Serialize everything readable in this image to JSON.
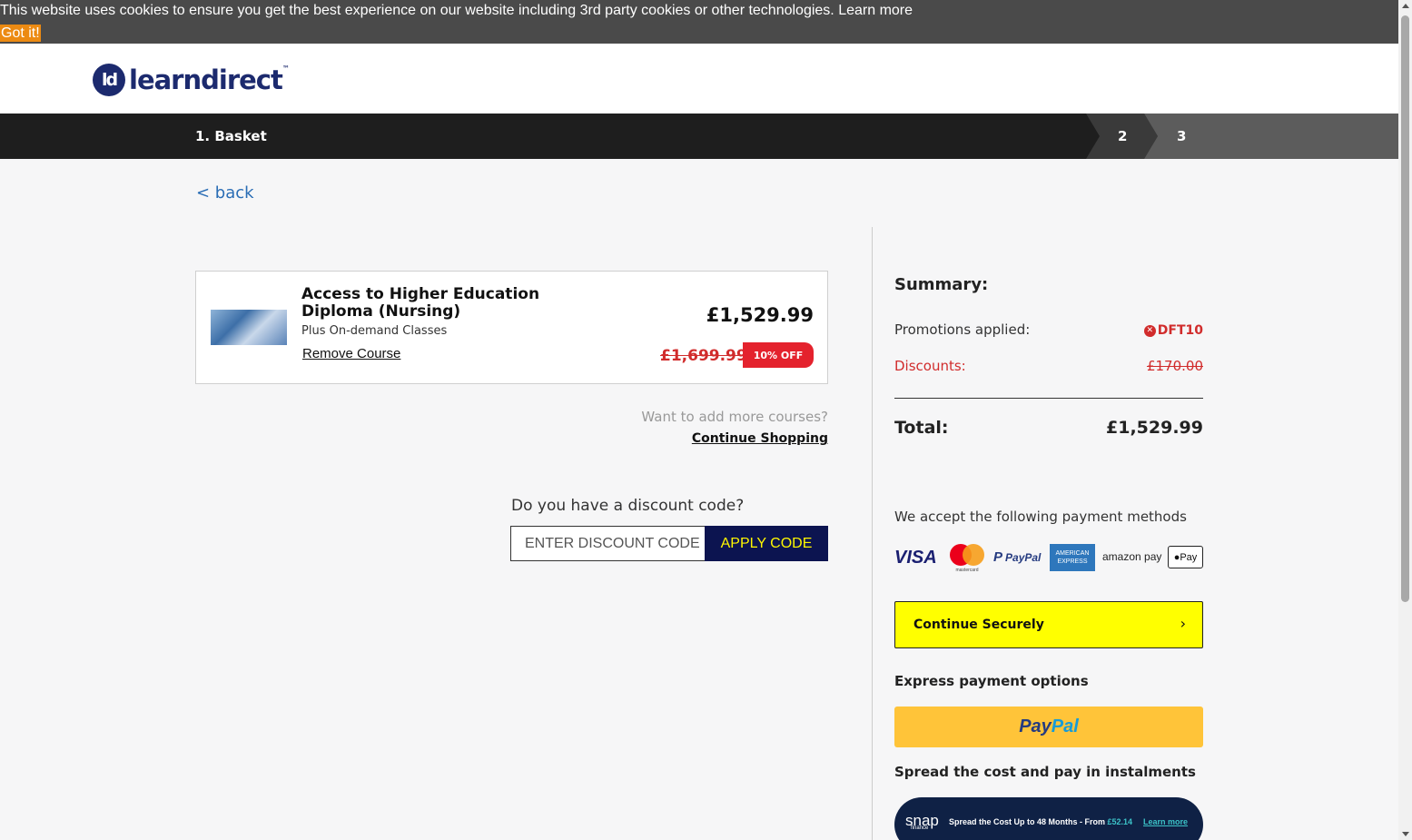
{
  "cookie": {
    "text": "This website uses cookies to ensure you get the best experience on our website including 3rd party cookies or other technologies. ",
    "learn_more": "Learn more",
    "button": "Got it!"
  },
  "brand": {
    "logo_mark": "ld",
    "logo_text": "learndirect",
    "tm": "™",
    "color": "#1c2a6e"
  },
  "progress": {
    "step1": "1. Basket",
    "step2": "2",
    "step3": "3"
  },
  "nav": {
    "back": "< back"
  },
  "course": {
    "title": "Access to Higher Education Diploma (Nursing)",
    "subtitle": "Plus On-demand Classes",
    "remove": "Remove Course",
    "price": "£1,529.99",
    "old_price": "£1,699.99",
    "badge": "10% OFF"
  },
  "more": {
    "question": "Want to add more courses?",
    "link": "Continue Shopping"
  },
  "discount": {
    "question": "Do you have a discount code?",
    "placeholder": "ENTER DISCOUNT CODE",
    "button": "APPLY CODE"
  },
  "summary": {
    "title": "Summary:",
    "promotions_label": "Promotions applied:",
    "promo_code": "DFT10",
    "discounts_label": "Discounts:",
    "discounts_amount": "£170.00",
    "total_label": "Total:",
    "total_amount": "£1,529.99",
    "accept_text": "We accept the following payment methods",
    "payment_methods": [
      "VISA",
      "mastercard",
      "PayPal",
      "AMERICAN EXPRESS",
      "amazon pay",
      "Pay"
    ],
    "continue": "Continue Securely",
    "continue_icon": "chevron-right-icon",
    "express_label": "Express payment options",
    "paypal_part1": "Pay",
    "paypal_part2": "Pal",
    "spread_label": "Spread the cost and pay in instalments"
  },
  "snap": {
    "logo": "snap",
    "finance": "finance",
    "text": "Spread the Cost Up to 48 Months - From ",
    "amount": "£52.14",
    "learn": "Learn more"
  },
  "colors": {
    "accent_yellow": "#ffff00",
    "navy": "#0c1450",
    "red": "#d12c2c",
    "cookie_orange": "#ec8a12"
  }
}
